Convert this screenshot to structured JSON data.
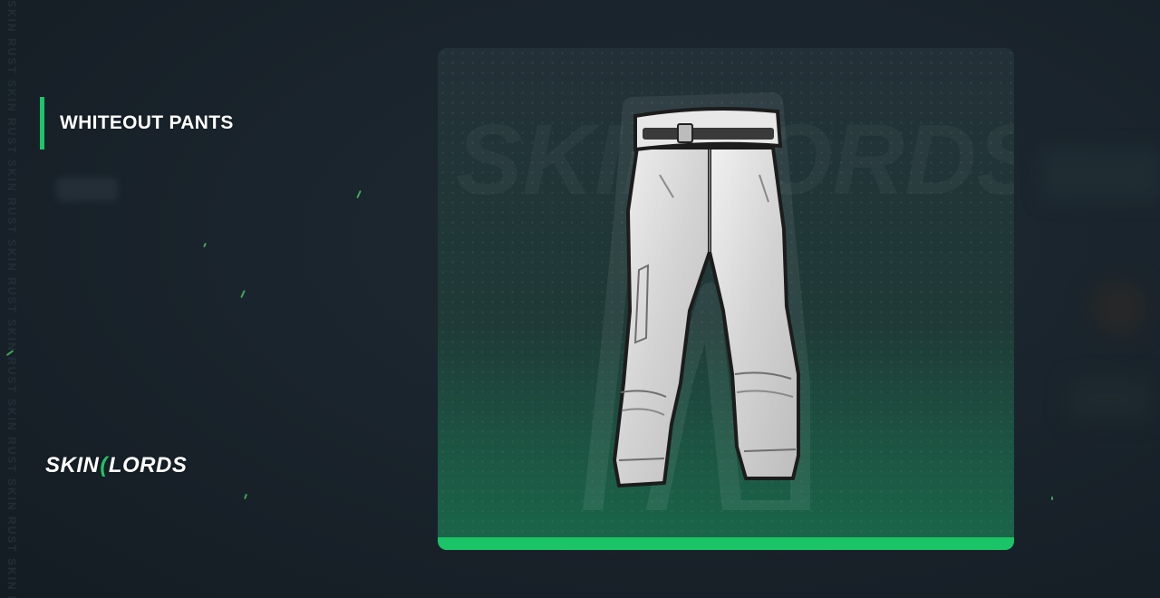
{
  "item": {
    "name": "WHITEOUT PANTS",
    "image_icon": "pants-icon"
  },
  "brand": {
    "logo_part1": "SKIN",
    "logo_part2": "LORDS",
    "accent_color": "#1ec46a",
    "watermark": "SKIN RUST SKIN RUST SKIN RUST SKIN RUST SKIN RUST SKIN RUST SKIN RUST SKIN RUST SKIN RUST SKIN"
  }
}
